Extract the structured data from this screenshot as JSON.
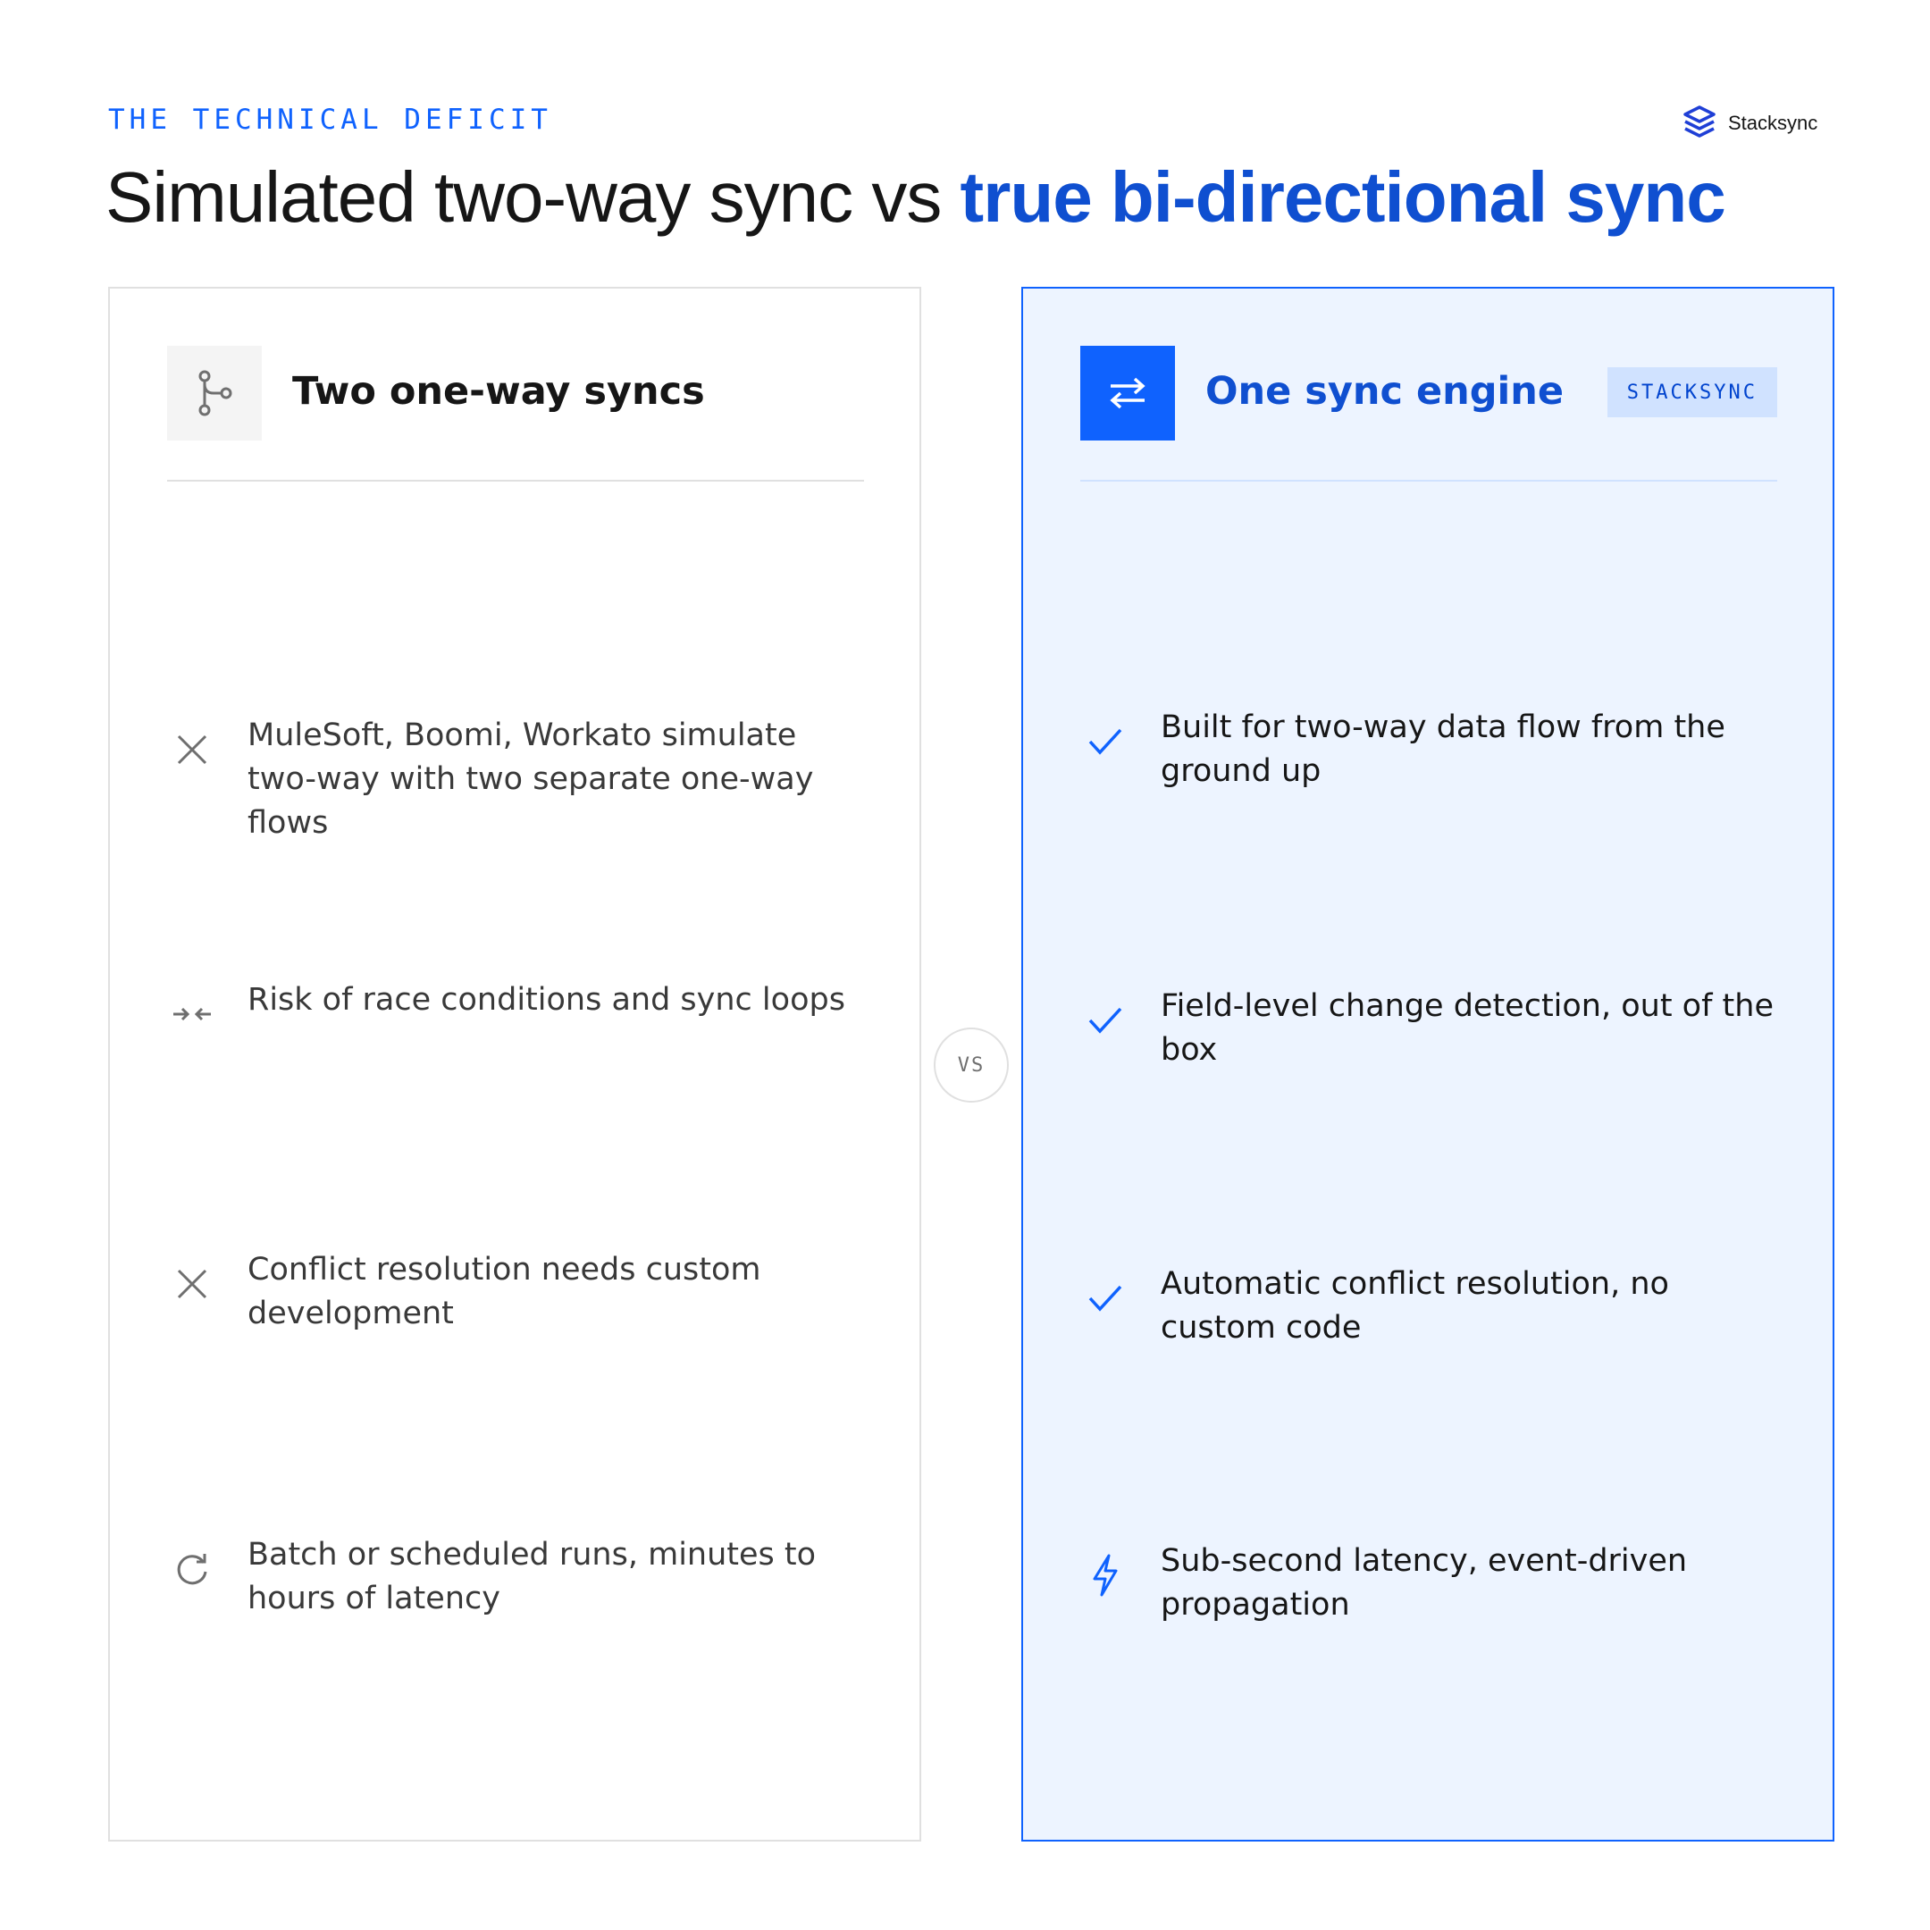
{
  "eyebrow": "THE TECHNICAL DEFICIT",
  "logo": {
    "name": "Stacksync",
    "icon": "stacked-layers-logo-icon",
    "color": "#1f3fd6"
  },
  "headline": {
    "regular": "Simulated two-way sync vs ",
    "highlight": "true bi-directional sync"
  },
  "left_panel": {
    "title": "Two one-way syncs",
    "icon": "branch-icon",
    "items": [
      {
        "icon": "x-icon",
        "text": "MuleSoft, Boomi, Workato simulate two-way with two separate one-way flows"
      },
      {
        "icon": "converge-arrows-icon",
        "text": "Risk of race conditions and sync loops"
      },
      {
        "icon": "x-icon",
        "text": "Conflict resolution needs custom development"
      },
      {
        "icon": "refresh-icon",
        "text": "Batch or scheduled runs, minutes to hours of latency"
      }
    ]
  },
  "vs_label": "VS",
  "right_panel": {
    "title": "One sync engine",
    "tag": "STACKSYNC",
    "icon": "two-way-arrows-icon",
    "items": [
      {
        "icon": "check-icon",
        "text": "Built for two-way data flow from the ground up"
      },
      {
        "icon": "check-icon",
        "text": "Field-level change detection, out of the box"
      },
      {
        "icon": "check-icon",
        "text": "Automatic conflict resolution, no custom code"
      },
      {
        "icon": "lightning-icon",
        "text": "Sub-second latency, event-driven propagation"
      }
    ]
  },
  "colors": {
    "accent": "#0f62fe",
    "accent_dark": "#0f4fd0",
    "panel_bg": "#edf4ff",
    "tag_bg": "#d0e2ff",
    "border": "#e0e0e0"
  }
}
